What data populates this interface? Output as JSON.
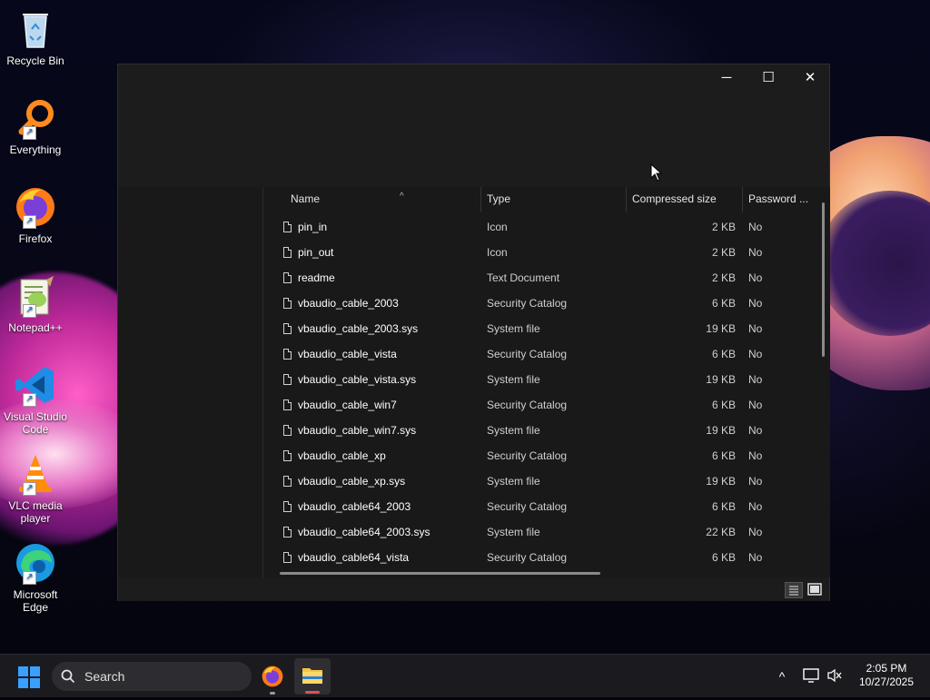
{
  "desktop": {
    "icons": [
      {
        "label": "Recycle Bin",
        "icon": "recycle-bin-icon"
      },
      {
        "label": "Everything",
        "icon": "everything-search-icon"
      },
      {
        "label": "Firefox",
        "icon": "firefox-icon"
      },
      {
        "label": "Notepad++",
        "icon": "notepad-plus-plus-icon"
      },
      {
        "label": "Visual Studio Code",
        "icon": "vscode-icon"
      },
      {
        "label": "VLC media player",
        "icon": "vlc-icon"
      },
      {
        "label": "Microsoft Edge",
        "icon": "edge-icon"
      }
    ]
  },
  "window": {
    "controls": {
      "minimize": "─",
      "maximize": "☐",
      "close": "✕"
    },
    "columns": {
      "name": "Name",
      "type": "Type",
      "compressed_size": "Compressed size",
      "password": "Password ..."
    },
    "sort_indicator": "^",
    "files": [
      {
        "name": "pin_in",
        "type": "Icon",
        "size": "2 KB",
        "password": "No"
      },
      {
        "name": "pin_out",
        "type": "Icon",
        "size": "2 KB",
        "password": "No"
      },
      {
        "name": "readme",
        "type": "Text Document",
        "size": "2 KB",
        "password": "No"
      },
      {
        "name": "vbaudio_cable_2003",
        "type": "Security Catalog",
        "size": "6 KB",
        "password": "No"
      },
      {
        "name": "vbaudio_cable_2003.sys",
        "type": "System file",
        "size": "19 KB",
        "password": "No"
      },
      {
        "name": "vbaudio_cable_vista",
        "type": "Security Catalog",
        "size": "6 KB",
        "password": "No"
      },
      {
        "name": "vbaudio_cable_vista.sys",
        "type": "System file",
        "size": "19 KB",
        "password": "No"
      },
      {
        "name": "vbaudio_cable_win7",
        "type": "Security Catalog",
        "size": "6 KB",
        "password": "No"
      },
      {
        "name": "vbaudio_cable_win7.sys",
        "type": "System file",
        "size": "19 KB",
        "password": "No"
      },
      {
        "name": "vbaudio_cable_xp",
        "type": "Security Catalog",
        "size": "6 KB",
        "password": "No"
      },
      {
        "name": "vbaudio_cable_xp.sys",
        "type": "System file",
        "size": "19 KB",
        "password": "No"
      },
      {
        "name": "vbaudio_cable64_2003",
        "type": "Security Catalog",
        "size": "6 KB",
        "password": "No"
      },
      {
        "name": "vbaudio_cable64_2003.sys",
        "type": "System file",
        "size": "22 KB",
        "password": "No"
      },
      {
        "name": "vbaudio_cable64_vista",
        "type": "Security Catalog",
        "size": "6 KB",
        "password": "No"
      }
    ]
  },
  "taskbar": {
    "search_placeholder": "Search",
    "pinned": [
      "firefox-icon",
      "file-explorer-icon"
    ],
    "tray_chevron": "^",
    "time": "2:05 PM",
    "date": "10/27/2025"
  },
  "colors": {
    "window_bg": "#1c1c1c",
    "accent": "#0a84ff",
    "taskbar_bg": "#1b1b1f"
  }
}
